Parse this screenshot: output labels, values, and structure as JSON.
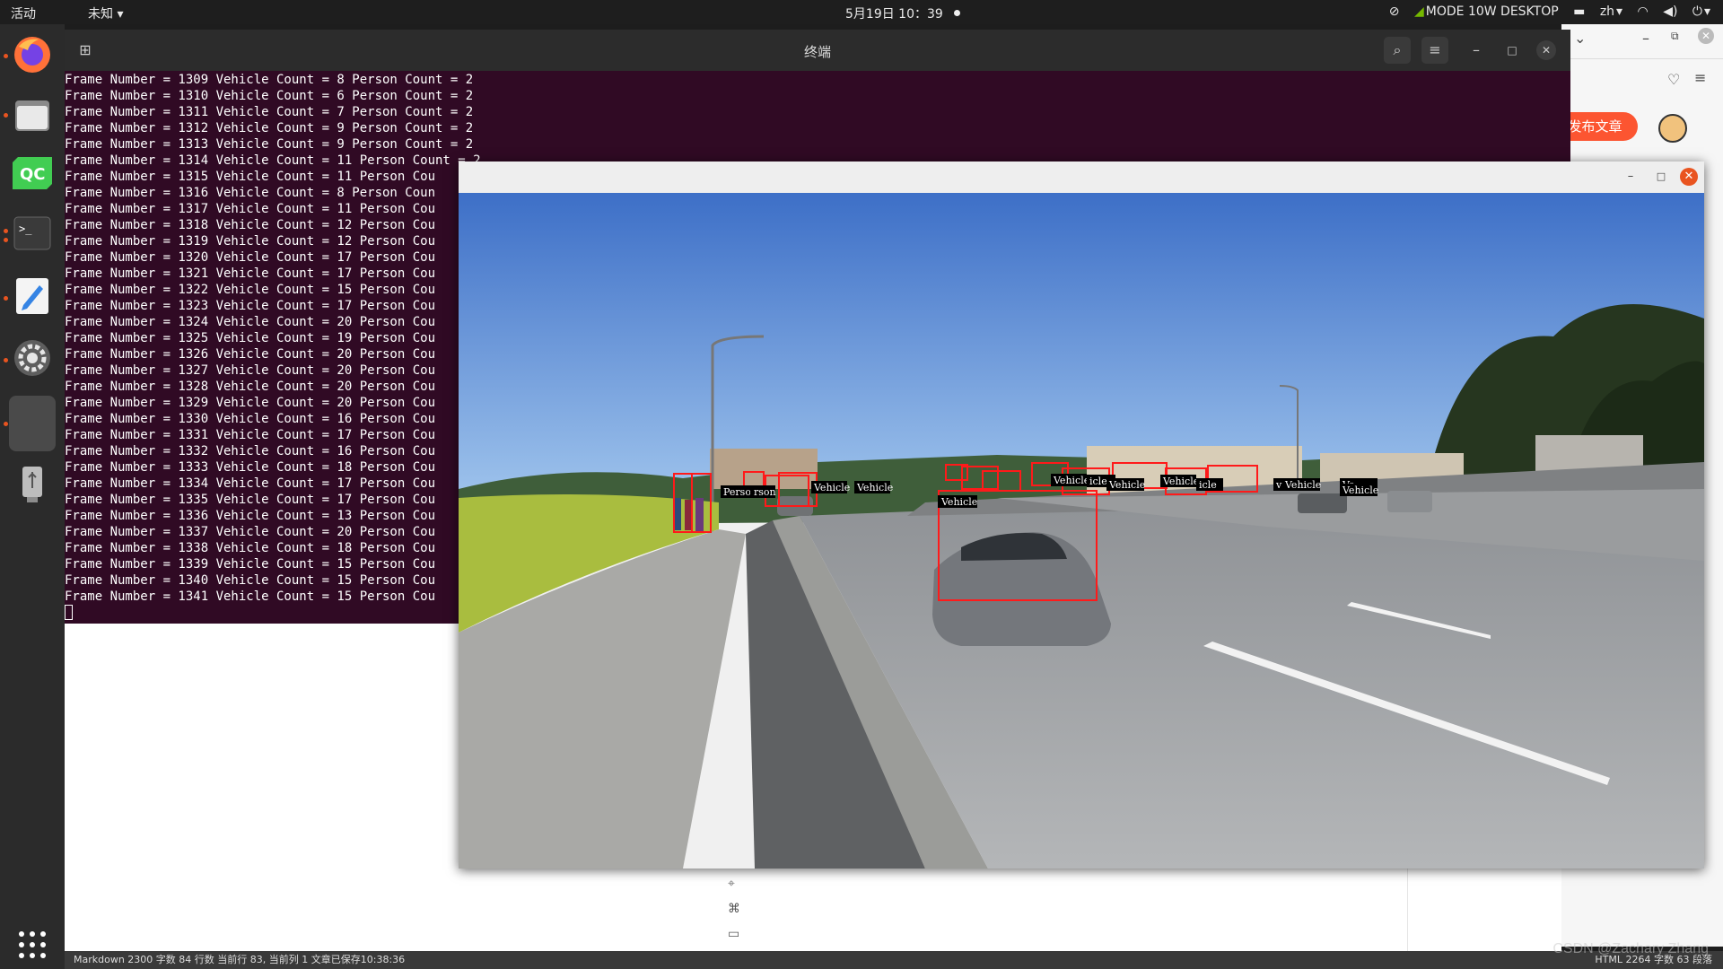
{
  "topbar": {
    "activities": "活动",
    "app_menu": "未知",
    "clock": "5月19日  10：39",
    "nvidia_mode": "MODE 10W DESKTOP",
    "input_method": "zh"
  },
  "terminal": {
    "title": "终端",
    "lines": [
      "Frame Number = 1309 Vehicle Count = 8 Person Count = 2",
      "Frame Number = 1310 Vehicle Count = 6 Person Count = 2",
      "Frame Number = 1311 Vehicle Count = 7 Person Count = 2",
      "Frame Number = 1312 Vehicle Count = 9 Person Count = 2",
      "Frame Number = 1313 Vehicle Count = 9 Person Count = 2",
      "Frame Number = 1314 Vehicle Count = 11 Person Count = 2",
      "Frame Number = 1315 Vehicle Count = 11 Person Cou",
      "Frame Number = 1316 Vehicle Count = 8 Person Coun",
      "Frame Number = 1317 Vehicle Count = 11 Person Cou",
      "Frame Number = 1318 Vehicle Count = 12 Person Cou",
      "Frame Number = 1319 Vehicle Count = 12 Person Cou",
      "Frame Number = 1320 Vehicle Count = 17 Person Cou",
      "Frame Number = 1321 Vehicle Count = 17 Person Cou",
      "Frame Number = 1322 Vehicle Count = 15 Person Cou",
      "Frame Number = 1323 Vehicle Count = 17 Person Cou",
      "Frame Number = 1324 Vehicle Count = 20 Person Cou",
      "Frame Number = 1325 Vehicle Count = 19 Person Cou",
      "Frame Number = 1326 Vehicle Count = 20 Person Cou",
      "Frame Number = 1327 Vehicle Count = 20 Person Cou",
      "Frame Number = 1328 Vehicle Count = 20 Person Cou",
      "Frame Number = 1329 Vehicle Count = 20 Person Cou",
      "Frame Number = 1330 Vehicle Count = 16 Person Cou",
      "Frame Number = 1331 Vehicle Count = 17 Person Cou",
      "Frame Number = 1332 Vehicle Count = 16 Person Cou",
      "Frame Number = 1333 Vehicle Count = 18 Person Cou",
      "Frame Number = 1334 Vehicle Count = 17 Person Cou",
      "Frame Number = 1335 Vehicle Count = 17 Person Cou",
      "Frame Number = 1336 Vehicle Count = 13 Person Cou",
      "Frame Number = 1337 Vehicle Count = 20 Person Cou",
      "Frame Number = 1338 Vehicle Count = 18 Person Cou",
      "Frame Number = 1339 Vehicle Count = 15 Person Cou",
      "Frame Number = 1340 Vehicle Count = 15 Person Cou",
      "Frame Number = 1341 Vehicle Count = 15 Person Cou"
    ]
  },
  "browser": {
    "publish_button": "发布文章"
  },
  "video": {
    "labels": {
      "person": "Person",
      "person_partial": "rson",
      "vehicle": "Vehicle",
      "vehicle_partial": "icle",
      "vehicle_partial2": "v",
      "vehicle_partial3": "Ve"
    }
  },
  "statusbar": {
    "left": "Markdown   2300 字数   84 行数   当前行 83, 当前列 1   文章已保存10:38:36",
    "right": "HTML   2264 字数   63 段落",
    "watermark": "CSDN @Zachary Zhang"
  },
  "colors": {
    "terminal_bg": "#300a24",
    "detection_box": "#ff1a1a",
    "accent": "#e95420",
    "publish": "#fc5531"
  }
}
